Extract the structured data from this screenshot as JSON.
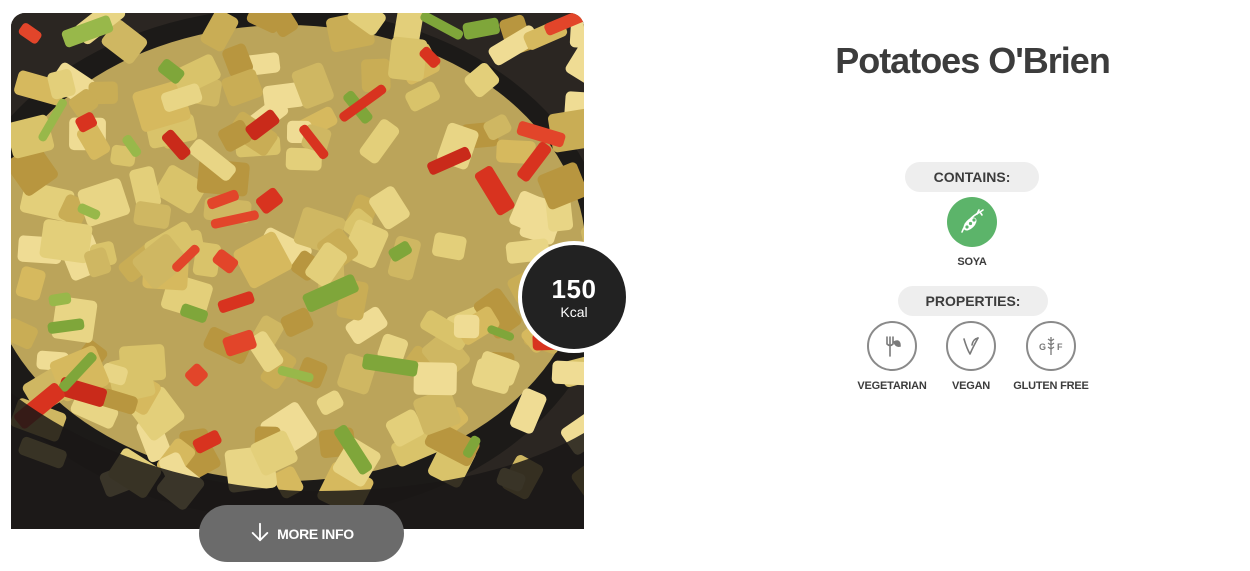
{
  "recipe": {
    "title": "Potatoes O'Brien",
    "calories": "150",
    "calories_unit": "Kcal",
    "more_info_label": "MORE INFO"
  },
  "contains": {
    "label": "CONTAINS:",
    "items": [
      {
        "label": "SOYA",
        "icon": "soy-bean-icon",
        "color": "#5cb46a"
      }
    ]
  },
  "properties": {
    "label": "PROPERTIES:",
    "items": [
      {
        "label": "VEGETARIAN",
        "icon": "fork-leaf-icon"
      },
      {
        "label": "VEGAN",
        "icon": "leaf-icon"
      },
      {
        "label": "GLUTEN FREE",
        "icon": "gluten-free-icon",
        "icon_text_left": "G",
        "icon_text_right": "F"
      }
    ]
  }
}
